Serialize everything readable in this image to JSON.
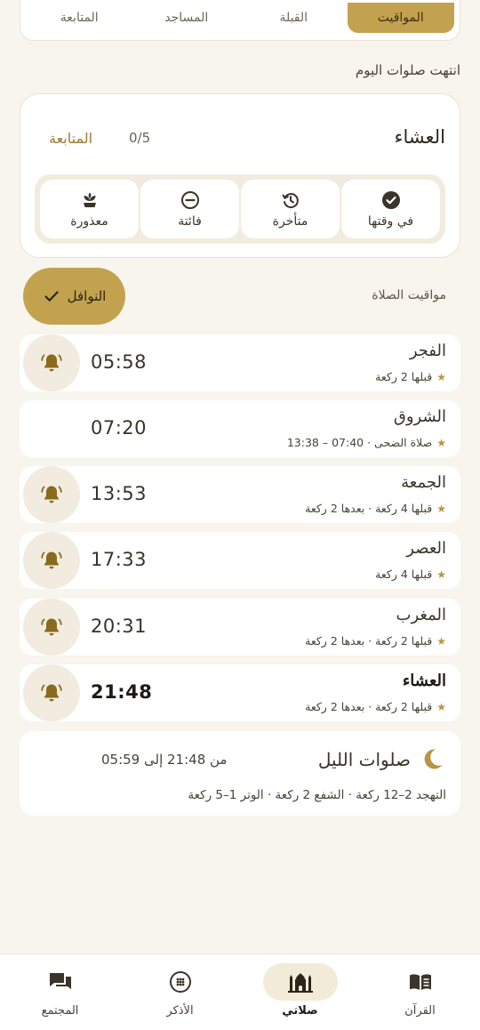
{
  "top_tabs": [
    {
      "label": "المواقيت",
      "active": true
    },
    {
      "label": "القبلة",
      "active": false
    },
    {
      "label": "المساجد",
      "active": false
    },
    {
      "label": "المتابعة",
      "active": false
    }
  ],
  "section_title": "انتهت صلوات اليوم",
  "tracker": {
    "prayer_name": "العشاء",
    "count": "0/5",
    "follow_label": "المتابعة",
    "statuses": [
      {
        "label": "في وقتها",
        "icon": "check-circle-icon"
      },
      {
        "label": "متأخرة",
        "icon": "history-clock-icon"
      },
      {
        "label": "فائتة",
        "icon": "minus-circle-icon"
      },
      {
        "label": "معذورة",
        "icon": "plant-icon"
      }
    ]
  },
  "nawafil_button": "النوافل",
  "times_label": "مواقيت الصلاة",
  "prayers": [
    {
      "name": "الفجر",
      "time": "05:58",
      "note": "قبلها 2 ركعة",
      "bell": true,
      "current": false
    },
    {
      "name": "الشروق",
      "time": "07:20",
      "note": "صلاة الضحى · 07:40 – 13:38",
      "bell": false,
      "current": false
    },
    {
      "name": "الجمعة",
      "time": "13:53",
      "note": "قبلها 4 ركعة · بعدها 2 ركعة",
      "bell": true,
      "current": false
    },
    {
      "name": "العصر",
      "time": "17:33",
      "note": "قبلها 4 ركعة",
      "bell": true,
      "current": false
    },
    {
      "name": "المغرب",
      "time": "20:31",
      "note": "قبلها 2 ركعة · بعدها 2 ركعة",
      "bell": true,
      "current": false
    },
    {
      "name": "العشاء",
      "time": "21:48",
      "note": "قبلها 2 ركعة · بعدها 2 ركعة",
      "bell": true,
      "current": true
    }
  ],
  "night": {
    "title": "صلوات الليل",
    "range": "من 21:48 إلى 05:59",
    "detail": "التهجد 2–12 ركعة · الشفع 2 ركعة · الوتر 1–5 ركعة"
  },
  "bottom_nav": [
    {
      "label": "القرآن",
      "icon": "book-icon",
      "active": false
    },
    {
      "label": "صلاتي",
      "icon": "mosque-icon",
      "active": true
    },
    {
      "label": "الأذكر",
      "icon": "tasbih-icon",
      "active": false
    },
    {
      "label": "المجتمع",
      "icon": "chat-icon",
      "active": false
    }
  ],
  "colors": {
    "accent": "#c3a24f",
    "background": "#f8f5ee",
    "card": "#ffffff",
    "star": "#b89540"
  }
}
